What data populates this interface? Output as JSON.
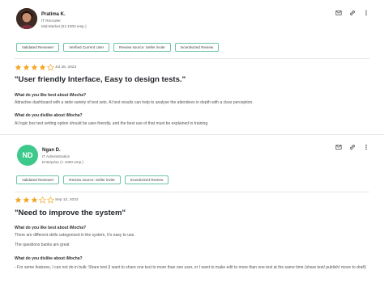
{
  "reviews": [
    {
      "reviewer": {
        "name": "Pratima K.",
        "role": "IT Recruiter",
        "company_size": "Mid-Market (51-1000 emp.)"
      },
      "badges": [
        "Validated Reviewer",
        "Verified Current User",
        "Review source: Seller invite",
        "Incentivized Review"
      ],
      "rating": 4,
      "date": "Jul 28, 2023",
      "title": "\"User friendly Interface, Easy to design tests.\"",
      "q1": "What do you like best about iMocha?",
      "a1": "Attractive dashboard with a wide variety of test sets. AI test results can help to analyse the attendees in depth with a clear perception.",
      "q2": "What do you dislike about iMocha?",
      "a2": "AI logic box test setting option should be user-friendly, and the best use of that must be explained in training."
    },
    {
      "reviewer": {
        "initials": "ND",
        "name": "Ngan D.",
        "role": "IT Administration",
        "company_size": "Enterprise (> 1000 emp.)"
      },
      "badges": [
        "Validated Reviewer",
        "Review source: Seller invite",
        "Incentivized Review"
      ],
      "rating": 3,
      "date": "Sep 12, 2022",
      "title": "\"Need to improve the system\"",
      "q1": "What do you like best about iMocha?",
      "a1": "There are different skills categorized in the system, It's easy to use.",
      "a1b": "The questions banks are great",
      "q2": "What do you dislike about iMocha?",
      "a2": "- For some features, I can not do in bulk: Share test (I want to share one test to more than one user, or I want to make edit to more than one test at the same time (share test/ publish/ move to draft)"
    }
  ],
  "colors": {
    "star": "#f5a623",
    "star_empty": "#d8d8d8",
    "badge_border": "#6cc4a0",
    "initials_bg": "#3ec98c"
  },
  "icons": [
    "mail-icon",
    "link-icon",
    "more-icon"
  ]
}
